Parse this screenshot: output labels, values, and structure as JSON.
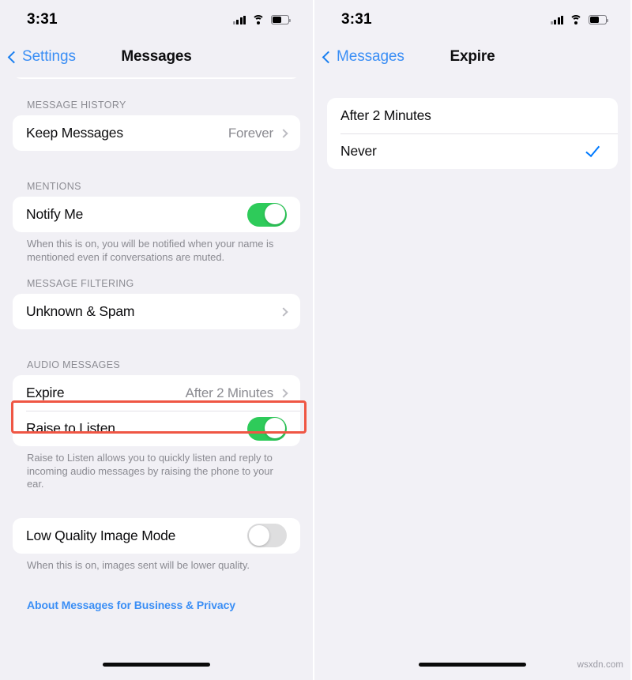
{
  "meta": {
    "watermark": "wsxdn.com"
  },
  "status_bar": {
    "time": "3:31",
    "icons": [
      "signal-bars-icon",
      "wifi-icon",
      "battery-icon"
    ],
    "battery_level_pct": 55
  },
  "colors": {
    "accent_blue": "#3a8ef5",
    "check_blue": "#007aff",
    "toggle_on_green": "#2ecb5a",
    "toggle_off_gray": "#dededf",
    "highlight_red": "#ef5644",
    "page_background": "#f1f0f5",
    "card_background": "#ffffff"
  },
  "left_panel": {
    "nav": {
      "back_label": "Settings",
      "title": "Messages"
    },
    "sections": [
      {
        "header": "MESSAGE HISTORY",
        "rows": [
          {
            "label": "Keep Messages",
            "value": "Forever",
            "type": "disclosure"
          }
        ],
        "footnote": ""
      },
      {
        "header": "MENTIONS",
        "rows": [
          {
            "label": "Notify Me",
            "value": "on",
            "type": "toggle"
          }
        ],
        "footnote": "When this is on, you will be notified when your name is mentioned even if conversations are muted."
      },
      {
        "header": "MESSAGE FILTERING",
        "rows": [
          {
            "label": "Unknown & Spam",
            "value": "",
            "type": "disclosure"
          }
        ],
        "footnote": ""
      },
      {
        "header": "AUDIO MESSAGES",
        "rows": [
          {
            "label": "Expire",
            "value": "After 2 Minutes",
            "type": "disclosure",
            "highlighted": true
          },
          {
            "label": "Raise to Listen",
            "value": "on",
            "type": "toggle"
          }
        ],
        "footnote": "Raise to Listen allows you to quickly listen and reply to incoming audio messages by raising the phone to your ear."
      },
      {
        "header": "",
        "rows": [
          {
            "label": "Low Quality Image Mode",
            "value": "off",
            "type": "toggle"
          }
        ],
        "footnote": "When this is on, images sent will be lower quality."
      }
    ],
    "link": "About Messages for Business & Privacy"
  },
  "right_panel": {
    "nav": {
      "back_label": "Messages",
      "title": "Expire"
    },
    "options": [
      {
        "label": "After 2 Minutes",
        "selected": false
      },
      {
        "label": "Never",
        "selected": true
      }
    ]
  }
}
